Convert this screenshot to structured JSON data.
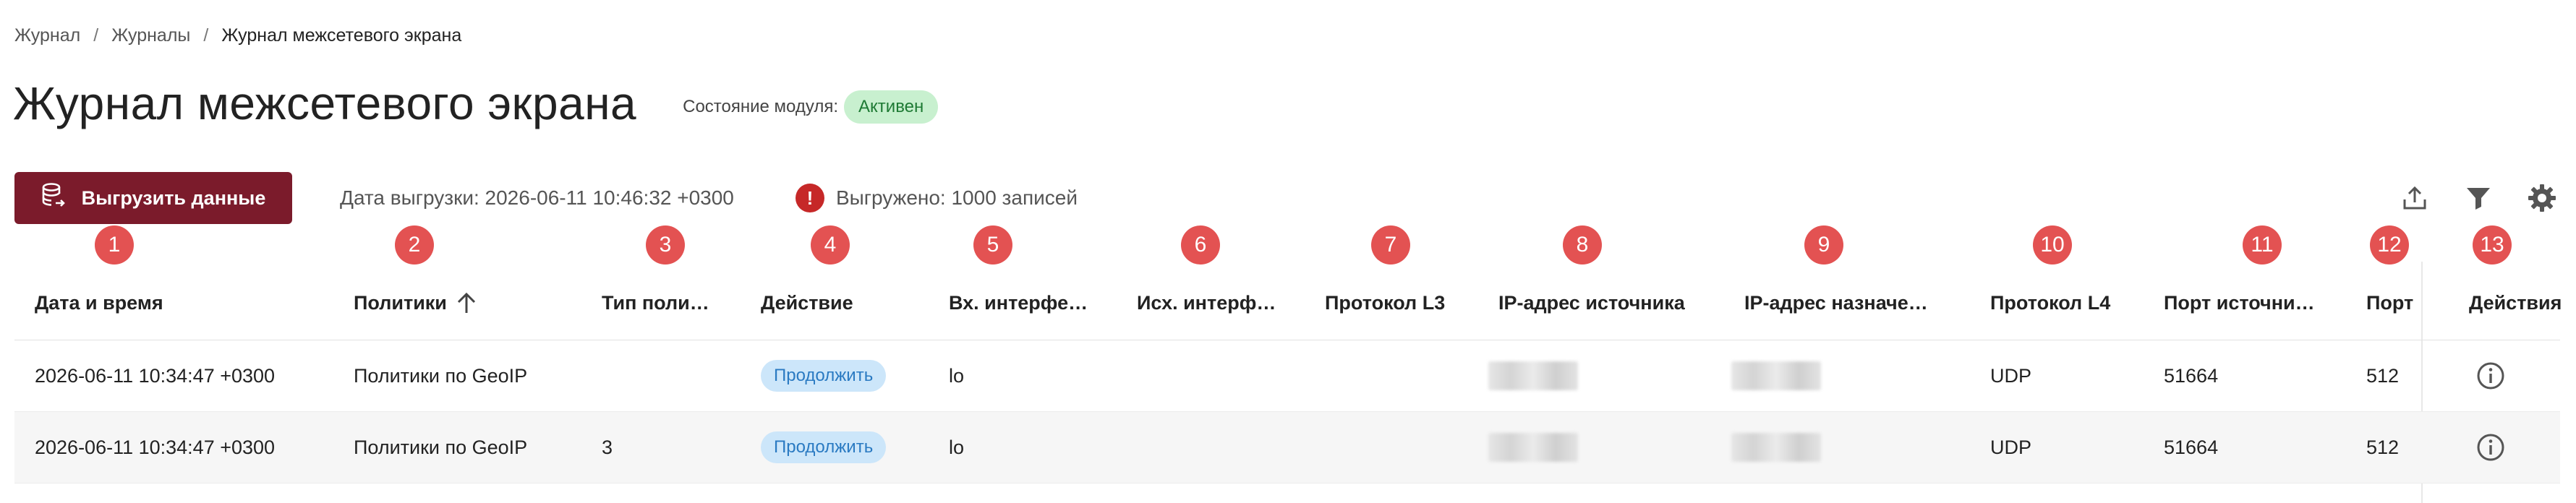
{
  "breadcrumb": {
    "items": [
      "Журнал",
      "Журналы",
      "Журнал межсетевого экрана"
    ],
    "separator": "/"
  },
  "page": {
    "title": "Журнал межсетевого экрана",
    "module_state_label": "Состояние модуля:",
    "module_state_value": "Активен"
  },
  "toolbar": {
    "export_button": "Выгрузить данные",
    "export_date": "Дата выгрузки: 2026-06-11 10:46:32 +0300",
    "exported_count": "Выгружено: 1000 записей",
    "warn_glyph": "!",
    "icons": [
      "upload-icon",
      "filter-icon",
      "settings-gear-icon"
    ]
  },
  "markers": [
    "1",
    "2",
    "3",
    "4",
    "5",
    "6",
    "7",
    "8",
    "9",
    "10",
    "11",
    "12",
    "13"
  ],
  "table": {
    "columns": [
      "Дата и время",
      "Политики",
      "Тип поли…",
      "Действие",
      "Вх. интерфе…",
      "Исх. интерф…",
      "Протокол L3",
      "IP-адрес источника",
      "IP-адрес назначе…",
      "Протокол L4",
      "Порт источни…",
      "Порт",
      "Действия"
    ],
    "sorted_column": "Политики",
    "sort_direction": "ascending",
    "rows": [
      {
        "datetime": "2026-06-11 10:34:47 +0300",
        "policy": "Политики по GeoIP",
        "policy_type": "",
        "action": "Продолжить",
        "in_iface": "lo",
        "out_iface": "",
        "proto_l3": "",
        "proto_l4": "UDP",
        "src_port": "51664",
        "dst_port": "512"
      },
      {
        "datetime": "2026-06-11 10:34:47 +0300",
        "policy": "Политики по GeoIP",
        "policy_type": "3",
        "action": "Продолжить",
        "in_iface": "lo",
        "out_iface": "",
        "proto_l3": "",
        "proto_l4": "UDP",
        "src_port": "51664",
        "dst_port": "512"
      }
    ]
  },
  "colors": {
    "primary": "#7b1b2b",
    "marker": "#e35252",
    "status_bg": "#c8f0cf",
    "status_text": "#1e7a34",
    "pill_bg": "#cce6fa",
    "pill_text": "#2a7ac2",
    "warning": "#c62828"
  }
}
